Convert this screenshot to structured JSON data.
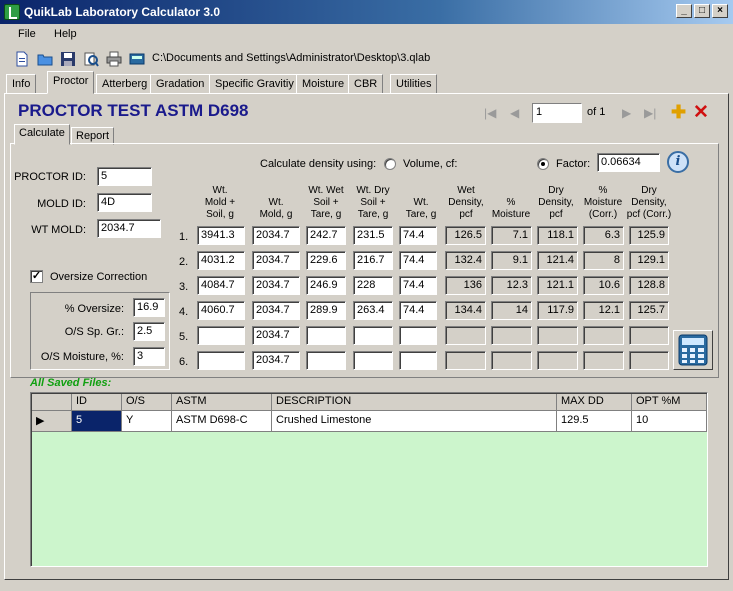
{
  "window": {
    "title": "QuikLab Laboratory Calculator 3.0"
  },
  "menu": [
    "File",
    "Help"
  ],
  "toolbar": {
    "path": "C:\\Documents and Settings\\Administrator\\Desktop\\3.qlab"
  },
  "tabs": [
    "Info",
    "Proctor",
    "Atterberg",
    "Gradation",
    "Specific Gravitiy",
    "Moisture",
    "CBR",
    "Utilities"
  ],
  "active_tab": "Proctor",
  "heading": "PROCTOR TEST ASTM D698",
  "nav": {
    "record": "1",
    "of_label": "of 1"
  },
  "subtabs": [
    "Calculate",
    "Report"
  ],
  "form": {
    "proctor_id_label": "PROCTOR ID:",
    "proctor_id": "5",
    "mold_id_label": "MOLD ID:",
    "mold_id": "4D",
    "wt_mold_label": "WT MOLD:",
    "wt_mold": "2034.7",
    "density_label": "Calculate density using:",
    "volume_label": "Volume, cf:",
    "factor_label": "Factor:",
    "factor": "0.06634",
    "density_mode": "factor",
    "oversize_label": "Oversize Correction",
    "oversize_checked": true,
    "pct_oversize_label": "% Oversize:",
    "pct_oversize": "16.9",
    "os_spgr_label": "O/S Sp. Gr.:",
    "os_spgr": "2.5",
    "os_moisture_label": "O/S Moisture, %:",
    "os_moisture": "3"
  },
  "columns": [
    [
      "Wt.",
      "Mold +",
      "Soil, g"
    ],
    [
      "Wt.",
      "Mold, g"
    ],
    [
      "Wt. Wet",
      "Soil +",
      "Tare, g"
    ],
    [
      "Wt. Dry",
      "Soil +",
      "Tare, g"
    ],
    [
      "Wt.",
      "Tare, g"
    ],
    [
      "Wet",
      "Density,",
      "pcf"
    ],
    [
      "%",
      "Moisture"
    ],
    [
      "Dry",
      "Density,",
      "pcf"
    ],
    [
      "%",
      "Moisture",
      "(Corr.)"
    ],
    [
      "Dry",
      "Density,",
      "pcf (Corr.)"
    ]
  ],
  "rows": [
    [
      "1.",
      "3941.3",
      "2034.7",
      "242.7",
      "231.5",
      "74.4",
      "126.5",
      "7.1",
      "118.1",
      "6.3",
      "125.9"
    ],
    [
      "2.",
      "4031.2",
      "2034.7",
      "229.6",
      "216.7",
      "74.4",
      "132.4",
      "9.1",
      "121.4",
      "8",
      "129.1"
    ],
    [
      "3.",
      "4084.7",
      "2034.7",
      "246.9",
      "228",
      "74.4",
      "136",
      "12.3",
      "121.1",
      "10.6",
      "128.8"
    ],
    [
      "4.",
      "4060.7",
      "2034.7",
      "289.9",
      "263.4",
      "74.4",
      "134.4",
      "14",
      "117.9",
      "12.1",
      "125.7"
    ],
    [
      "5.",
      "",
      "2034.7",
      "",
      "",
      "",
      "",
      "",
      "",
      "",
      ""
    ],
    [
      "6.",
      "",
      "2034.7",
      "",
      "",
      "",
      "",
      "",
      "",
      "",
      ""
    ]
  ],
  "saved": {
    "label": "All Saved Files:",
    "headers": [
      "ID",
      "O/S",
      "ASTM",
      "DESCRIPTION",
      "MAX DD",
      "OPT %M"
    ],
    "rows": [
      [
        "5",
        "Y",
        "ASTM D698-C",
        "Crushed Limestone",
        "129.5",
        "10"
      ]
    ]
  }
}
